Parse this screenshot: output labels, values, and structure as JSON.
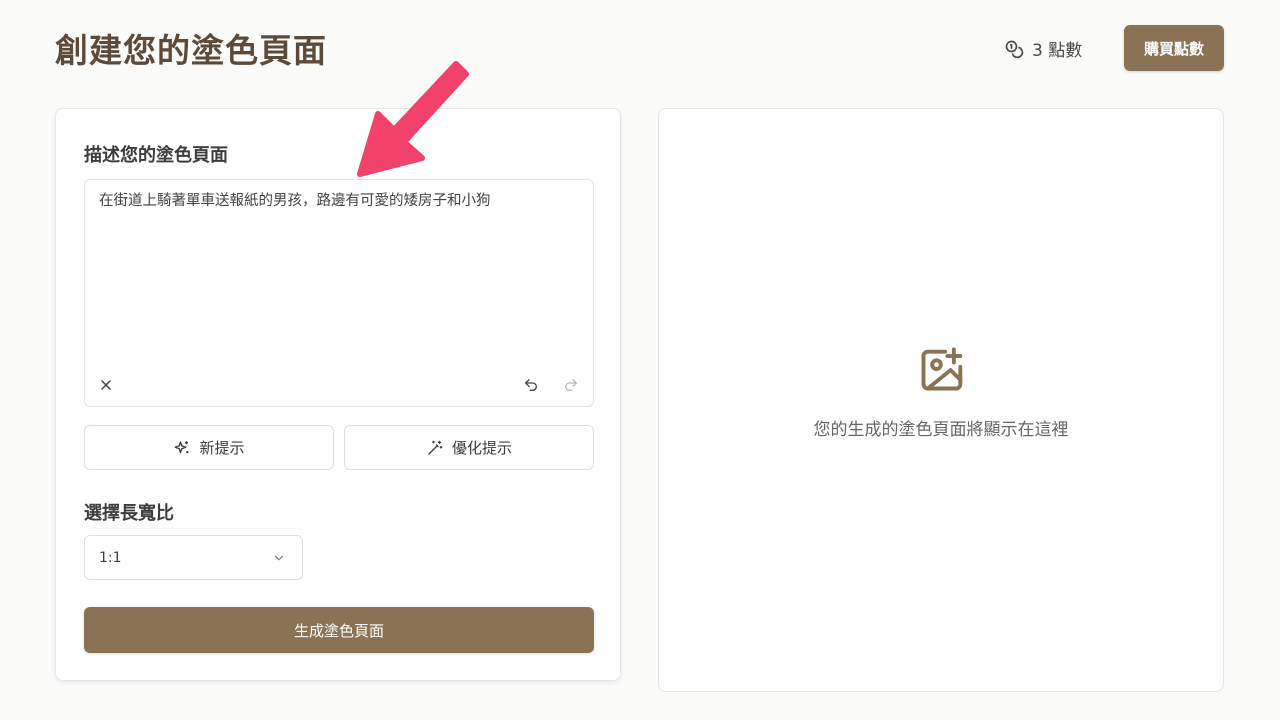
{
  "header": {
    "title": "創建您的塗色頁面",
    "credits_text": "3 點數",
    "buy_label": "購買點數"
  },
  "form": {
    "describe_label": "描述您的塗色頁面",
    "prompt_value": "在街道上騎著單車送報紙的男孩，路邊有可愛的矮房子和小狗",
    "new_prompt_label": "新提示",
    "optimize_prompt_label": "優化提示",
    "aspect_label": "選擇長寬比",
    "aspect_value": "1:1",
    "generate_label": "生成塗色頁面"
  },
  "preview": {
    "placeholder_text": "您的生成的塗色頁面將顯示在這裡"
  },
  "colors": {
    "brand": "#8a7355",
    "title": "#5e4a38",
    "annotation_arrow": "#f2416b"
  },
  "icons": {
    "credits": "coins-icon",
    "clear": "close-icon",
    "undo": "undo-icon",
    "redo": "redo-icon",
    "new_prompt": "sparkles-icon",
    "optimize": "magic-wand-icon",
    "dropdown": "chevron-down-icon",
    "placeholder": "image-plus-icon"
  }
}
